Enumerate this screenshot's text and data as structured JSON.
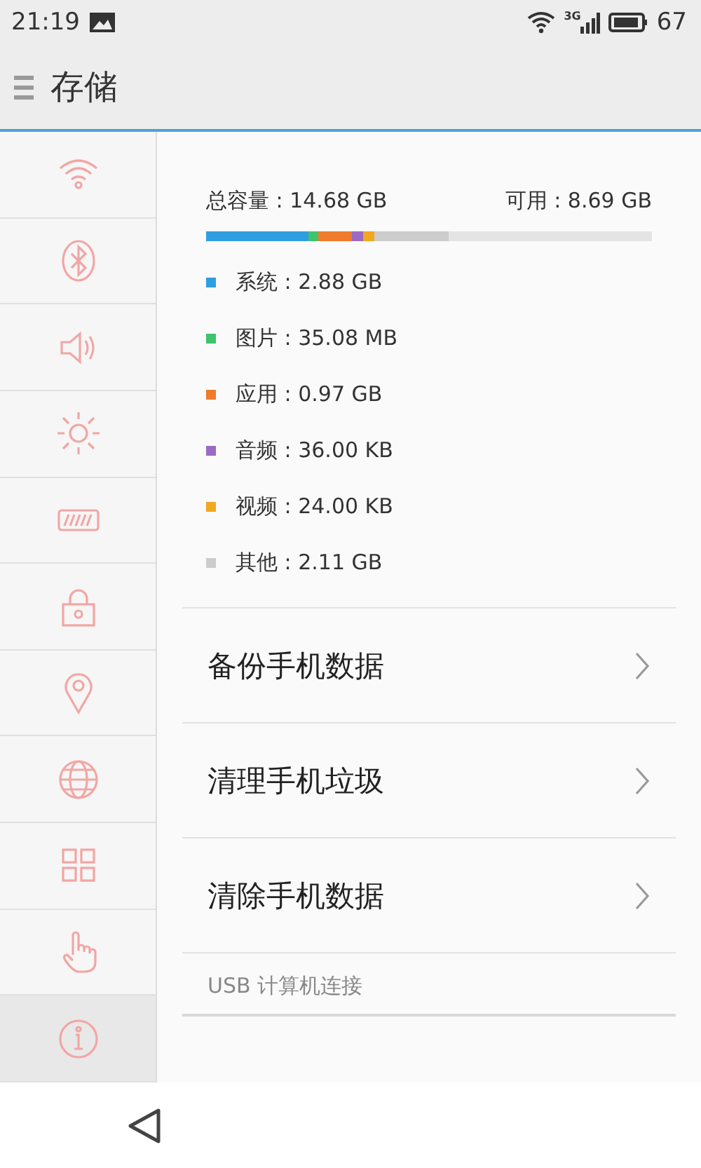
{
  "status_bar": {
    "time": "21:19",
    "network": "3G",
    "battery": "67"
  },
  "title_bar": {
    "title": "存储"
  },
  "sidebar": {
    "items": [
      {
        "selected": false
      },
      {
        "selected": false
      },
      {
        "selected": false
      },
      {
        "selected": false
      },
      {
        "selected": false
      },
      {
        "selected": false
      },
      {
        "selected": false
      },
      {
        "selected": false
      },
      {
        "selected": false
      },
      {
        "selected": false
      },
      {
        "selected": true
      }
    ]
  },
  "storage": {
    "total": "总容量 : 14.68 GB",
    "available": "可用 : 8.69 GB",
    "categories": [
      {
        "label": "系统 : 2.88 GB",
        "color": "#2f9ee0"
      },
      {
        "label": "图片 : 35.08 MB",
        "color": "#3ec46d"
      },
      {
        "label": "应用 : 0.97 GB",
        "color": "#f07b2c"
      },
      {
        "label": "音频 : 36.00 KB",
        "color": "#9b6bc4"
      },
      {
        "label": "视频 : 24.00 KB",
        "color": "#f0a820"
      },
      {
        "label": "其他 : 2.11 GB",
        "color": "#cccccc"
      }
    ]
  },
  "actions": [
    {
      "label": "备份手机数据"
    },
    {
      "label": "清理手机垃圾"
    },
    {
      "label": "清除手机数据"
    }
  ],
  "section_header": "USB 计算机连接"
}
